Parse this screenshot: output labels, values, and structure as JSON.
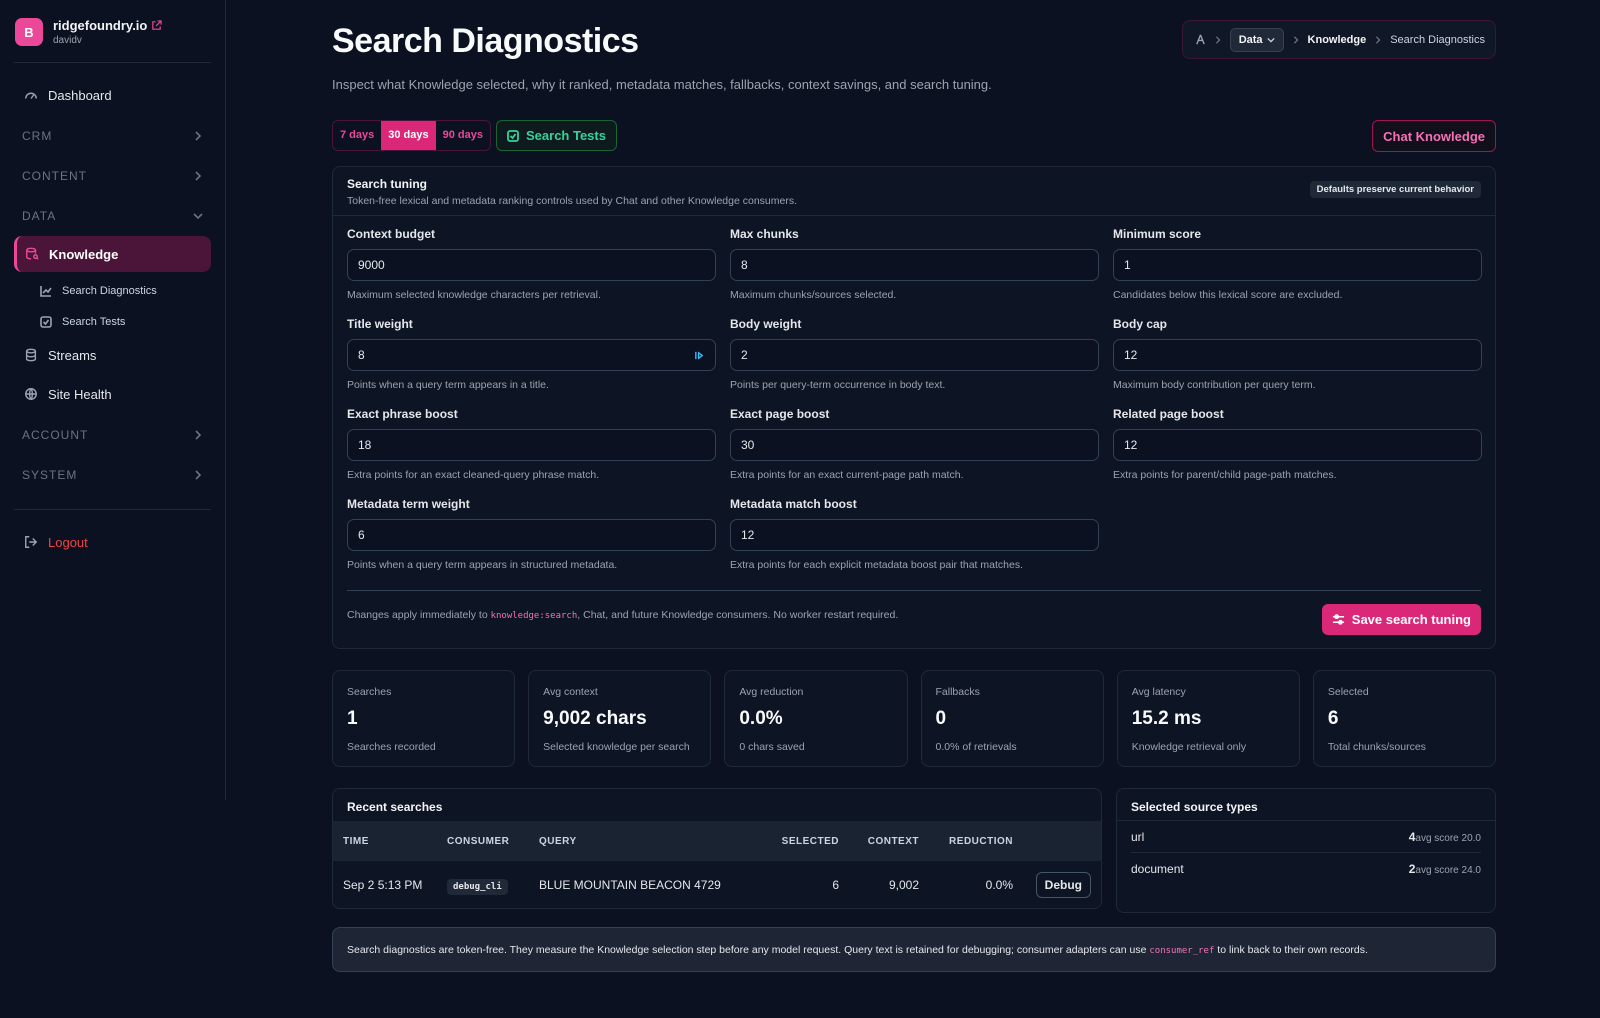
{
  "brand": {
    "logo_letter": "B",
    "name": "ridgefoundry.io",
    "user": "davidv"
  },
  "sidebar": {
    "dashboard": "Dashboard",
    "sections": {
      "crm": "CRM",
      "content": "CONTENT",
      "data": "DATA",
      "account": "ACCOUNT",
      "system": "SYSTEM"
    },
    "knowledge": "Knowledge",
    "sub_search_diagnostics": "Search Diagnostics",
    "sub_search_tests": "Search Tests",
    "streams": "Streams",
    "site_health": "Site Health",
    "logout": "Logout"
  },
  "header": {
    "title": "Search Diagnostics",
    "subtitle": "Inspect what Knowledge selected, why it ranked, metadata matches, fallbacks, context savings, and search tuning."
  },
  "breadcrumb": {
    "data": "Data",
    "knowledge": "Knowledge",
    "current": "Search Diagnostics"
  },
  "toolbar": {
    "ranges": [
      "7 days",
      "30 days",
      "90 days"
    ],
    "active_range": "30 days",
    "search_tests": "Search Tests",
    "chat_knowledge": "Chat Knowledge"
  },
  "tuning": {
    "title": "Search tuning",
    "description": "Token-free lexical and metadata ranking controls used by Chat and other Knowledge consumers.",
    "badge": "Defaults preserve current behavior",
    "fields": {
      "context_budget": {
        "label": "Context budget",
        "value": "9000",
        "help": "Maximum selected knowledge characters per retrieval."
      },
      "max_chunks": {
        "label": "Max chunks",
        "value": "8",
        "help": "Maximum chunks/sources selected."
      },
      "minimum_score": {
        "label": "Minimum score",
        "value": "1",
        "help": "Candidates below this lexical score are excluded."
      },
      "title_weight": {
        "label": "Title weight",
        "value": "8",
        "help": "Points when a query term appears in a title."
      },
      "body_weight": {
        "label": "Body weight",
        "value": "2",
        "help": "Points per query-term occurrence in body text."
      },
      "body_cap": {
        "label": "Body cap",
        "value": "12",
        "help": "Maximum body contribution per query term."
      },
      "exact_phrase_boost": {
        "label": "Exact phrase boost",
        "value": "18",
        "help": "Extra points for an exact cleaned-query phrase match."
      },
      "exact_page_boost": {
        "label": "Exact page boost",
        "value": "30",
        "help": "Extra points for an exact current-page path match."
      },
      "related_page_boost": {
        "label": "Related page boost",
        "value": "12",
        "help": "Extra points for parent/child page-path matches."
      },
      "metadata_term_weight": {
        "label": "Metadata term weight",
        "value": "6",
        "help": "Points when a query term appears in structured metadata."
      },
      "metadata_match_boost": {
        "label": "Metadata match boost",
        "value": "12",
        "help": "Extra points for each explicit metadata boost pair that matches."
      }
    },
    "footer_pre": "Changes apply immediately to ",
    "footer_code": "knowledge:search",
    "footer_post": ", Chat, and future Knowledge consumers. No worker restart required.",
    "save_label": "Save search tuning"
  },
  "stats": [
    {
      "label": "Searches",
      "value": "1",
      "sub": "Searches recorded"
    },
    {
      "label": "Avg context",
      "value": "9,002 chars",
      "sub": "Selected knowledge per search"
    },
    {
      "label": "Avg reduction",
      "value": "0.0%",
      "sub": "0 chars saved"
    },
    {
      "label": "Fallbacks",
      "value": "0",
      "sub": "0.0% of retrievals"
    },
    {
      "label": "Avg latency",
      "value": "15.2 ms",
      "sub": "Knowledge retrieval only"
    },
    {
      "label": "Selected",
      "value": "6",
      "sub": "Total chunks/sources"
    }
  ],
  "recent": {
    "title": "Recent searches",
    "columns": [
      "TIME",
      "CONSUMER",
      "QUERY",
      "SELECTED",
      "CONTEXT",
      "REDUCTION"
    ],
    "rows": [
      {
        "time": "Sep 2 5:13 PM",
        "consumer": "debug_cli",
        "query": "BLUE MOUNTAIN BEACON 4729",
        "selected": "6",
        "context": "9,002",
        "reduction": "0.0%",
        "action": "Debug"
      }
    ]
  },
  "sources": {
    "title": "Selected source types",
    "rows": [
      {
        "type": "url",
        "count": "4",
        "score": "avg score 20.0"
      },
      {
        "type": "document",
        "count": "2",
        "score": "avg score 24.0"
      }
    ]
  },
  "note": {
    "pre": "Search diagnostics are token-free. They measure the Knowledge selection step before any model request. Query text is retained for debugging; consumer adapters can use ",
    "code": "consumer_ref",
    "post": " to link back to their own records."
  },
  "colors": {
    "accent": "#ec4899",
    "success": "#34d399",
    "danger": "#ef4444",
    "background": "#0b1120"
  }
}
